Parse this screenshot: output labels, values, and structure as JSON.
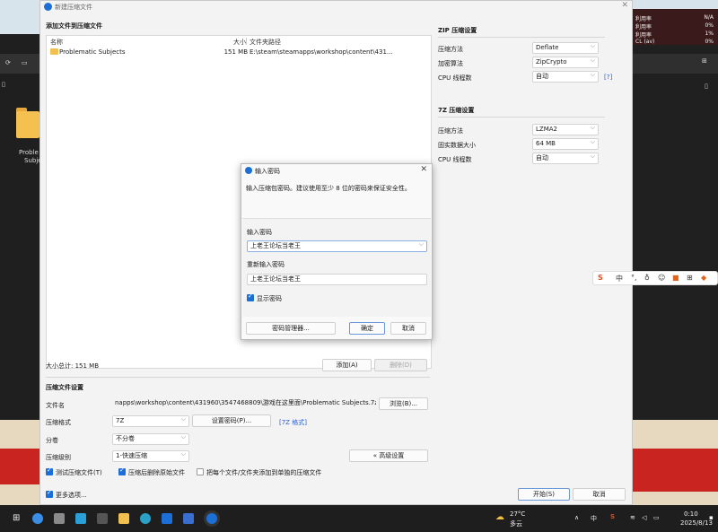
{
  "window": {
    "title": "新建压缩文件",
    "close": "✕"
  },
  "files": {
    "section_title": "添加文件到压缩文件",
    "columns": {
      "name": "名称",
      "size": "大小",
      "path": "文件夹路径"
    },
    "rows": [
      {
        "name": "Problematic Subjects",
        "size": "151 MB",
        "path": "E:\\steam\\steamapps\\workshop\\content\\431..."
      }
    ],
    "total": "大小总计: 151 MB",
    "add_label": "添加(A)",
    "delete_label": "删除(D)"
  },
  "compress": {
    "section_title": "压缩文件设置",
    "filename_label": "文件名",
    "filename_value": "napps\\workshop\\content\\431960\\3547468809\\游戏在这里面\\Problematic Subjects.7z",
    "browse_label": "浏览(B)...",
    "format_label": "压缩格式",
    "format_value": "7Z",
    "set_password_label": "设置密码(P)...",
    "format_link": "[7Z 格式]",
    "split_label": "分卷",
    "split_value": "不分卷",
    "level_label": "压缩级别",
    "level_value": "1-快速压缩",
    "advanced_label": "« 高级设置",
    "test_label": "测试压缩文件(T)",
    "delete_after_label": "压缩后删除原始文件",
    "each_separate_label": "把每个文件/文件夹添加到单独的压缩文件",
    "more_options_label": "更多选项...",
    "start_label": "开始(S)",
    "cancel_label": "取消"
  },
  "zip_settings": {
    "title": "ZIP 压缩设置",
    "method_label": "压缩方法",
    "method_value": "Deflate",
    "encrypt_label": "加密算法",
    "encrypt_value": "ZipCrypto",
    "threads_label": "CPU 线程数",
    "threads_value": "自动",
    "help": "[?]"
  },
  "z7_settings": {
    "title": "7Z 压缩设置",
    "method_label": "压缩方法",
    "method_value": "LZMA2",
    "solid_label": "固实数据大小",
    "solid_value": "64 MB",
    "threads_label": "CPU 线程数",
    "threads_value": "自动"
  },
  "dialog": {
    "title": "输入密码",
    "close": "✕",
    "message": "输入压缩包密码。建议使用至少 8 位的密码来保证安全性。",
    "password_label": "输入密码",
    "password_value": "上老王论坛当老王",
    "confirm_label": "重新输入密码",
    "confirm_value": "上老王论坛当老王",
    "show_password_label": "显示密码",
    "manager_label": "密码管理器...",
    "ok_label": "确定",
    "cancel_label": "取消"
  },
  "desktop": {
    "stats": [
      {
        "label": "利用率",
        "value": "N/A"
      },
      {
        "label": "利用率",
        "value": "0%"
      },
      {
        "label": "利用率",
        "value": "1%"
      },
      {
        "label": "CL (av)",
        "value": "0%"
      }
    ],
    "folder_label_1": "Proble",
    "folder_label_2": "Subje"
  },
  "ime": {
    "lang": "中"
  },
  "taskbar": {
    "weather_temp": "27°C",
    "weather_desc": "多云",
    "lang": "中",
    "time": "0:10",
    "date": "2025/8/13"
  },
  "colors": {
    "accent": "#1c6fd6",
    "link": "#2a5bd6",
    "banner_red": "#c9241f"
  }
}
